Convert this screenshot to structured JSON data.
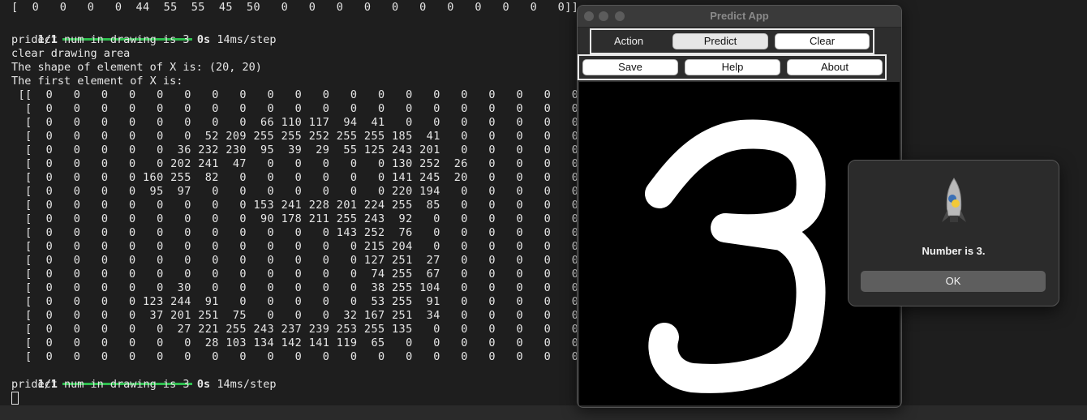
{
  "terminal": {
    "top_partial": "[  0   0   0   0  44  55  55  45  50   0   0   0   0   0   0   0   0   0   0   0]]",
    "progress1": {
      "step": "1/1",
      "time": "0s",
      "rate": "14ms/step",
      "fraction": 1.0
    },
    "predict_msg1": "pridect num in drawing is 3",
    "clear_msg": "clear drawing area",
    "shape_msg": "The shape of element of X is: (20, 20)",
    "first_msg": "The first element of X is:",
    "matrix_rows": [
      " [[  0   0   0   0   0   0   0   0   0   0   0   0   0   0   0   0   0   0   0   0]",
      "  [  0   0   0   0   0   0   0   0   0   0   0   0   0   0   0   0   0   0   0   0]",
      "  [  0   0   0   0   0   0   0   0  66 110 117  94  41   0   0   0   0   0   0   0]",
      "  [  0   0   0   0   0   0  52 209 255 255 252 255 255 185  41   0   0   0   0   0]",
      "  [  0   0   0   0   0  36 232 230  95  39  29  55 125 243 201   0   0   0   0   0]",
      "  [  0   0   0   0   0 202 241  47   0   0   0   0   0 130 252  26   0   0   0   0]",
      "  [  0   0   0   0 160 255  82   0   0   0   0   0   0 141 245  20   0   0   0   0]",
      "  [  0   0   0   0  95  97   0   0   0   0   0   0   0 220 194   0   0   0   0   0]",
      "  [  0   0   0   0   0   0   0   0 153 241 228 201 224 255  85   0   0   0   0   0]",
      "  [  0   0   0   0   0   0   0   0  90 178 211 255 243  92   0   0   0   0   0   0]",
      "  [  0   0   0   0   0   0   0   0   0   0   0 143 252  76   0   0   0   0   0   0]",
      "  [  0   0   0   0   0   0   0   0   0   0   0   0 215 204   0   0   0   0   0   0]",
      "  [  0   0   0   0   0   0   0   0   0   0   0   0 127 251  27   0   0   0   0   0]",
      "  [  0   0   0   0   0   0   0   0   0   0   0   0  74 255  67   0   0   0   0   0]",
      "  [  0   0   0   0   0  30   0   0   0   0   0   0  38 255 104   0   0   0   0   0]",
      "  [  0   0   0   0 123 244  91   0   0   0   0   0  53 255  91   0   0   0   0   0]",
      "  [  0   0   0   0  37 201 251  75   0   0   0  32 167 251  34   0   0   0   0   0]",
      "  [  0   0   0   0   0  27 221 255 243 237 239 253 255 135   0   0   0   0   0   0]",
      "  [  0   0   0   0   0   0  28 103 134 142 141 119  65   0   0   0   0   0   0   0]",
      "  [  0   0   0   0   0   0   0   0   0   0   0   0   0   0   0   0   0   0   0   0]]"
    ],
    "progress2": {
      "step": "1/1",
      "time": "0s",
      "rate": "14ms/step",
      "fraction": 1.0
    },
    "predict_msg2": "pridect num in drawing is 3"
  },
  "app": {
    "title": "Predict App",
    "toolbar1": {
      "label": "Action",
      "buttons": [
        "Predict",
        "Clear"
      ]
    },
    "toolbar2": {
      "buttons": [
        "Save",
        "Help",
        "About"
      ]
    },
    "canvas_digit": "3"
  },
  "dialog": {
    "icon": "python-rocket-icon",
    "message": "Number is 3.",
    "ok_label": "OK"
  },
  "colors": {
    "terminal_bg": "#1e1e1e",
    "progress_green": "#2fbe4f",
    "window_bg": "#2d2d2d",
    "ok_button": "#5e5e5e"
  }
}
